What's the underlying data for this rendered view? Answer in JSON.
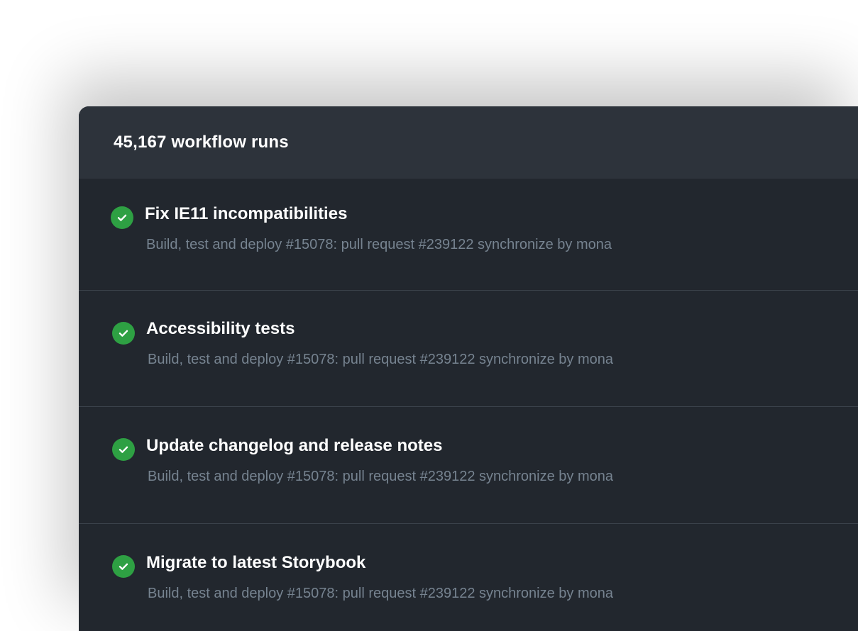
{
  "header": {
    "title": "45,167 workflow runs"
  },
  "colors": {
    "panel_bg": "#22272e",
    "header_bg": "#2d333b",
    "success": "#2ea043",
    "muted_text": "#768390"
  },
  "runs": [
    {
      "status": "success",
      "icon": "check-circle-icon",
      "title": "Fix IE11 incompatibilities",
      "subtitle": "Build, test and deploy #15078: pull request #239122 synchronize by mona"
    },
    {
      "status": "success",
      "icon": "check-circle-icon",
      "title": "Accessibility tests",
      "subtitle": "Build, test and deploy #15078: pull request #239122 synchronize by mona"
    },
    {
      "status": "success",
      "icon": "check-circle-icon",
      "title": "Update changelog and release notes",
      "subtitle": "Build, test and deploy #15078: pull request #239122 synchronize by mona"
    },
    {
      "status": "success",
      "icon": "check-circle-icon",
      "title": "Migrate to latest Storybook",
      "subtitle": "Build, test and deploy #15078: pull request #239122 synchronize by mona"
    }
  ]
}
